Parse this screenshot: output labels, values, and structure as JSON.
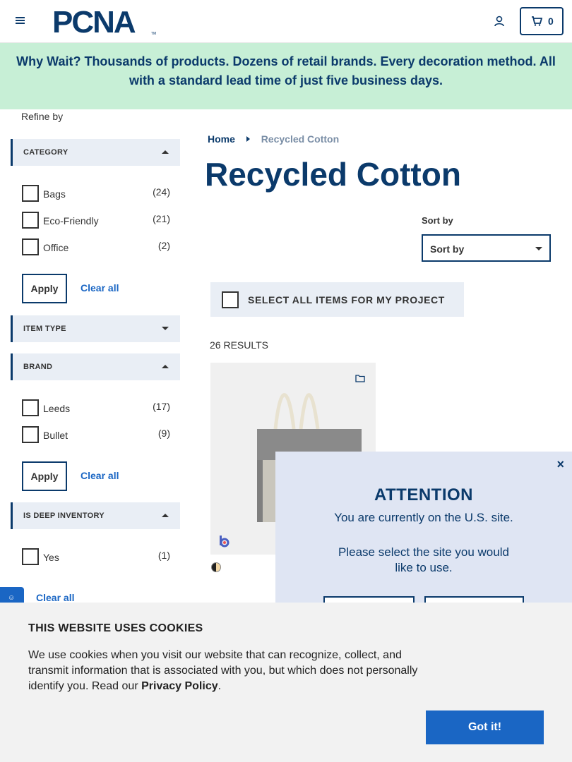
{
  "header": {
    "logo_text": "PCNA",
    "logo_tm": "TM",
    "cart_count": "0"
  },
  "banner": {
    "line1": "Why Wait? Thousands of products. Dozens of retail brands. Every decoration method. All",
    "line2": "with a standard lead time of just five business days."
  },
  "sidebar": {
    "refine_label": "Refine by",
    "category": {
      "title": "CATEGORY",
      "options": [
        {
          "label": "Bags",
          "count": "(24)"
        },
        {
          "label": "Eco-Friendly",
          "count": "(21)"
        },
        {
          "label": "Office",
          "count": "(2)"
        }
      ],
      "apply": "Apply",
      "clear": "Clear all"
    },
    "item_type": {
      "title": "ITEM TYPE"
    },
    "brand": {
      "title": "BRAND",
      "options": [
        {
          "label": "Leeds",
          "count": "(17)"
        },
        {
          "label": "Bullet",
          "count": "(9)"
        }
      ],
      "apply": "Apply",
      "clear": "Clear all"
    },
    "deep_inventory": {
      "title": "IS DEEP INVENTORY",
      "options": [
        {
          "label": "Yes",
          "count": "(1)"
        }
      ],
      "clear": "Clear all"
    }
  },
  "main": {
    "breadcrumb": {
      "home": "Home",
      "current": "Recycled Cotton"
    },
    "title": "Recycled Cotton",
    "sort_label": "Sort by",
    "sort_value": "Sort by",
    "select_all_label": "SELECT ALL ITEMS FOR MY PROJECT",
    "results": "26 RESULTS"
  },
  "modal": {
    "close": "×",
    "title": "ATTENTION",
    "line1": "You are currently on the U.S. site.",
    "line2": "Please select the site you would",
    "line3": "like to use."
  },
  "cookie": {
    "title": "THIS WEBSITE USES COOKIES",
    "text_before": "We use cookies when you visit our website that can recognize, collect, and transmit information that is associated with you, but which does not personally identify you. Read our ",
    "link": "Privacy Policy",
    "text_after": ".",
    "button": "Got it!"
  },
  "colors": {
    "brand_navy": "#0b3a6b",
    "banner_green": "#c7efd6",
    "link_blue": "#1a66c4"
  }
}
